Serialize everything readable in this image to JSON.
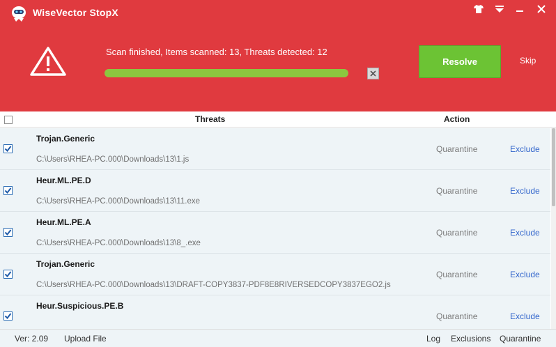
{
  "app": {
    "title": "WiseVector StopX"
  },
  "colors": {
    "header": "#e03a3f",
    "resolve": "#6cc334",
    "progress": "#8cc63f",
    "link": "#3366cc"
  },
  "icons": [
    "robot-logo-icon",
    "tshirt-skin-icon",
    "menu-icon",
    "minimize-icon",
    "close-icon",
    "warning-icon",
    "stop-scan-icon",
    "checkbox-checked-icon"
  ],
  "scan": {
    "status": "Scan finished, Items scanned: 13, Threats detected: 12",
    "progress": 1.0
  },
  "buttons": {
    "resolve": "Resolve",
    "skip": "Skip"
  },
  "columns": {
    "threats": "Threats",
    "action": "Action"
  },
  "threats": [
    {
      "name": "Trojan.Generic",
      "path": "C:\\Users\\RHEA-PC.000\\Downloads\\13\\1.js",
      "action": "Quarantine",
      "exclude": "Exclude",
      "checked": true
    },
    {
      "name": "Heur.ML.PE.D",
      "path": "C:\\Users\\RHEA-PC.000\\Downloads\\13\\11.exe",
      "action": "Quarantine",
      "exclude": "Exclude",
      "checked": true
    },
    {
      "name": "Heur.ML.PE.A",
      "path": "C:\\Users\\RHEA-PC.000\\Downloads\\13\\8_.exe",
      "action": "Quarantine",
      "exclude": "Exclude",
      "checked": true
    },
    {
      "name": "Trojan.Generic",
      "path": "C:\\Users\\RHEA-PC.000\\Downloads\\13\\DRAFT-COPY3837-PDF8E8RIVERSEDCOPY3837EGO2.js",
      "action": "Quarantine",
      "exclude": "Exclude",
      "checked": true
    },
    {
      "name": "Heur.Suspicious.PE.B",
      "path": "",
      "action": "Quarantine",
      "exclude": "Exclude",
      "checked": true
    }
  ],
  "footer": {
    "version": "Ver: 2.09",
    "upload": "Upload File",
    "log": "Log",
    "exclusions": "Exclusions",
    "quarantine": "Quarantine"
  }
}
